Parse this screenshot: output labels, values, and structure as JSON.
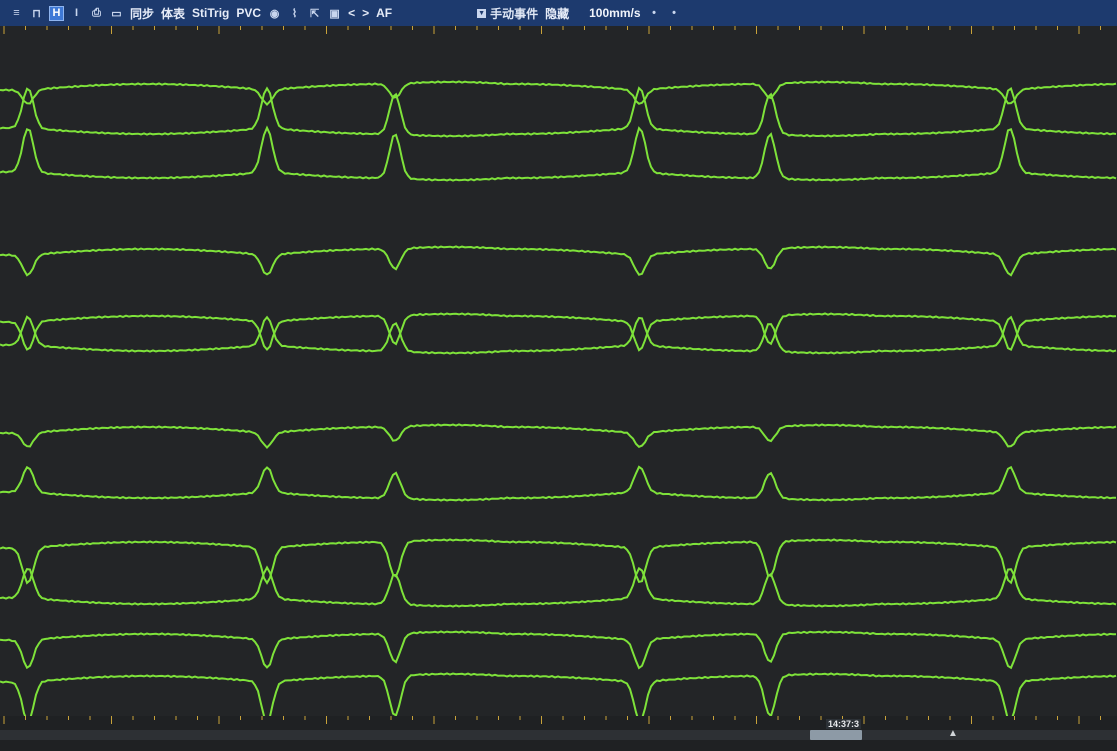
{
  "toolbar": {
    "icons": [
      "menu-icon",
      "pulse-icon",
      "caliper-icon",
      "text-cursor-icon",
      "print-icon",
      "monitor-icon"
    ],
    "sync_label": "同步",
    "surface_label": "体表",
    "stitrig_label": "StiTrig",
    "pvc_label": "PVC",
    "tool_icons": [
      "globe-icon",
      "signal-icon",
      "export-icon",
      "window-icon"
    ],
    "prev_label": "<",
    "next_label": ">",
    "af_label": "AF",
    "event_dropdown": "手动事件",
    "hidden_label": "隐藏",
    "speed": "100mm/s",
    "trace_color": "#7ee23a",
    "toolbar_color": "#1d3a6e"
  },
  "timeline": {
    "time": "14:37:3"
  }
}
